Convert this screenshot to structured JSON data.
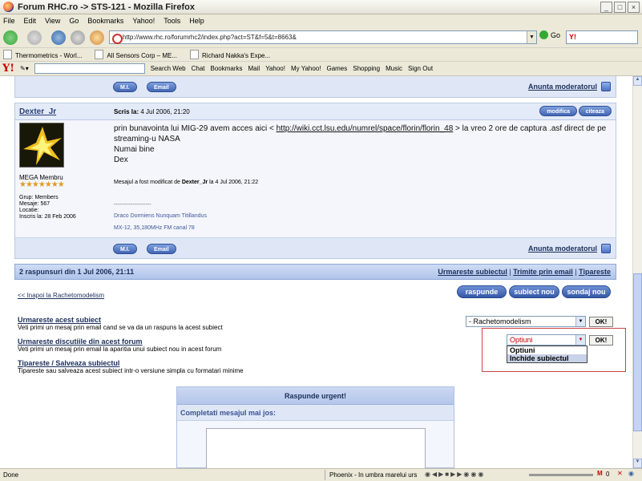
{
  "window": {
    "title": "Forum RHC.ro -> STS-121 - Mozilla Firefox",
    "buttons": [
      "_",
      "□",
      "×"
    ]
  },
  "menu": [
    "File",
    "Edit",
    "View",
    "Go",
    "Bookmarks",
    "Yahoo!",
    "Tools",
    "Help"
  ],
  "nav": {
    "url": "http://www.rhc.ro/forumrhc2/index.php?act=ST&f=5&t=8663&",
    "go": "Go",
    "search_brand": "Y!"
  },
  "bookmarks": [
    "Thermometrics - Worl...",
    "All Sensors Corp – ME...",
    "Richard Nakka's Expe..."
  ],
  "yahoo_toolbar": {
    "logo": "Y!",
    "search_web": "Search Web",
    "items": [
      "Chat",
      "Bookmarks",
      "Mail",
      "Yahoo!",
      "My Yahoo!",
      "Games",
      "Shopping",
      "Music",
      "Sign Out"
    ]
  },
  "post_prev": {
    "mi": "M.I.",
    "email": "Email",
    "report": "Anunta moderatorul"
  },
  "post": {
    "author": "Dexter_Jr",
    "written_label": "Scris la:",
    "written_date": "4 Jul 2006, 21:20",
    "actions": [
      "modifica",
      "citeaza"
    ],
    "rank": "MEGA Membru",
    "stars": "★★★★★★★",
    "meta": [
      "Grup: Members",
      "Mesaje: 567",
      "Locatie:",
      "Inscris la: 28 Feb 2006"
    ],
    "body_text": "prin bunavointa lui MIG-29 avem acces aici < ",
    "body_link": "http://wiki.cct.lsu.edu/numrel/space/florin/florin_48",
    "body_rest": " > la vreo 2 ore de captura .asf direct de pe streaming-u NASA",
    "line2": "Numai bine",
    "line3": "Dex",
    "edit_prefix": "Mesajul a fost modificat de ",
    "edit_author": "Dexter_Jr",
    "edit_suffix": " la 4 Jul 2006, 21:22",
    "sig_line": "--------------------",
    "sig1": "Draco Dormiens Nunquam Titillandus",
    "sig2": "MX-12, 35,180MHz FM canal 78",
    "mi": "M.I.",
    "email": "Email",
    "report": "Anunta moderatorul"
  },
  "summary": {
    "text": "2 raspunsuri din 1 Jul 2006, 21:11",
    "links": [
      "Urmareste subiectul",
      "Trimite prin email",
      "Tipareste"
    ]
  },
  "back_link": "<< Inapoi la Rachetomodelism",
  "big_buttons": [
    "raspunde",
    "subiect nou",
    "sondaj nou"
  ],
  "options": [
    {
      "title": "Urmareste acest subiect",
      "desc": "Veti primi un mesaj prin email cand se va da un raspuns la acest subiect"
    },
    {
      "title": "Urmareste discutiile din acest forum",
      "desc": "Veti primi un mesaj prin email la aparitia unui subiect nou in acest forum"
    },
    {
      "title": "Tipareste / Salveaza subiectul",
      "desc": "Tipareste sau salveaza acest subiect intr-o versiune simpla cu formatari minime"
    }
  ],
  "forum_select": {
    "value": "- Rachetomodelism",
    "ok": "OK!"
  },
  "opt_select": {
    "value": "Optiuni",
    "ok": "OK!",
    "list": [
      "Optiuni",
      "Inchide subiectul"
    ]
  },
  "quick_reply": {
    "title": "Raspunde urgent!",
    "subtitle": "Completati mesajul mai jos:"
  },
  "status": {
    "left": "Done",
    "song": "Phoenix - In umbra marelui urs",
    "mail": "0"
  }
}
